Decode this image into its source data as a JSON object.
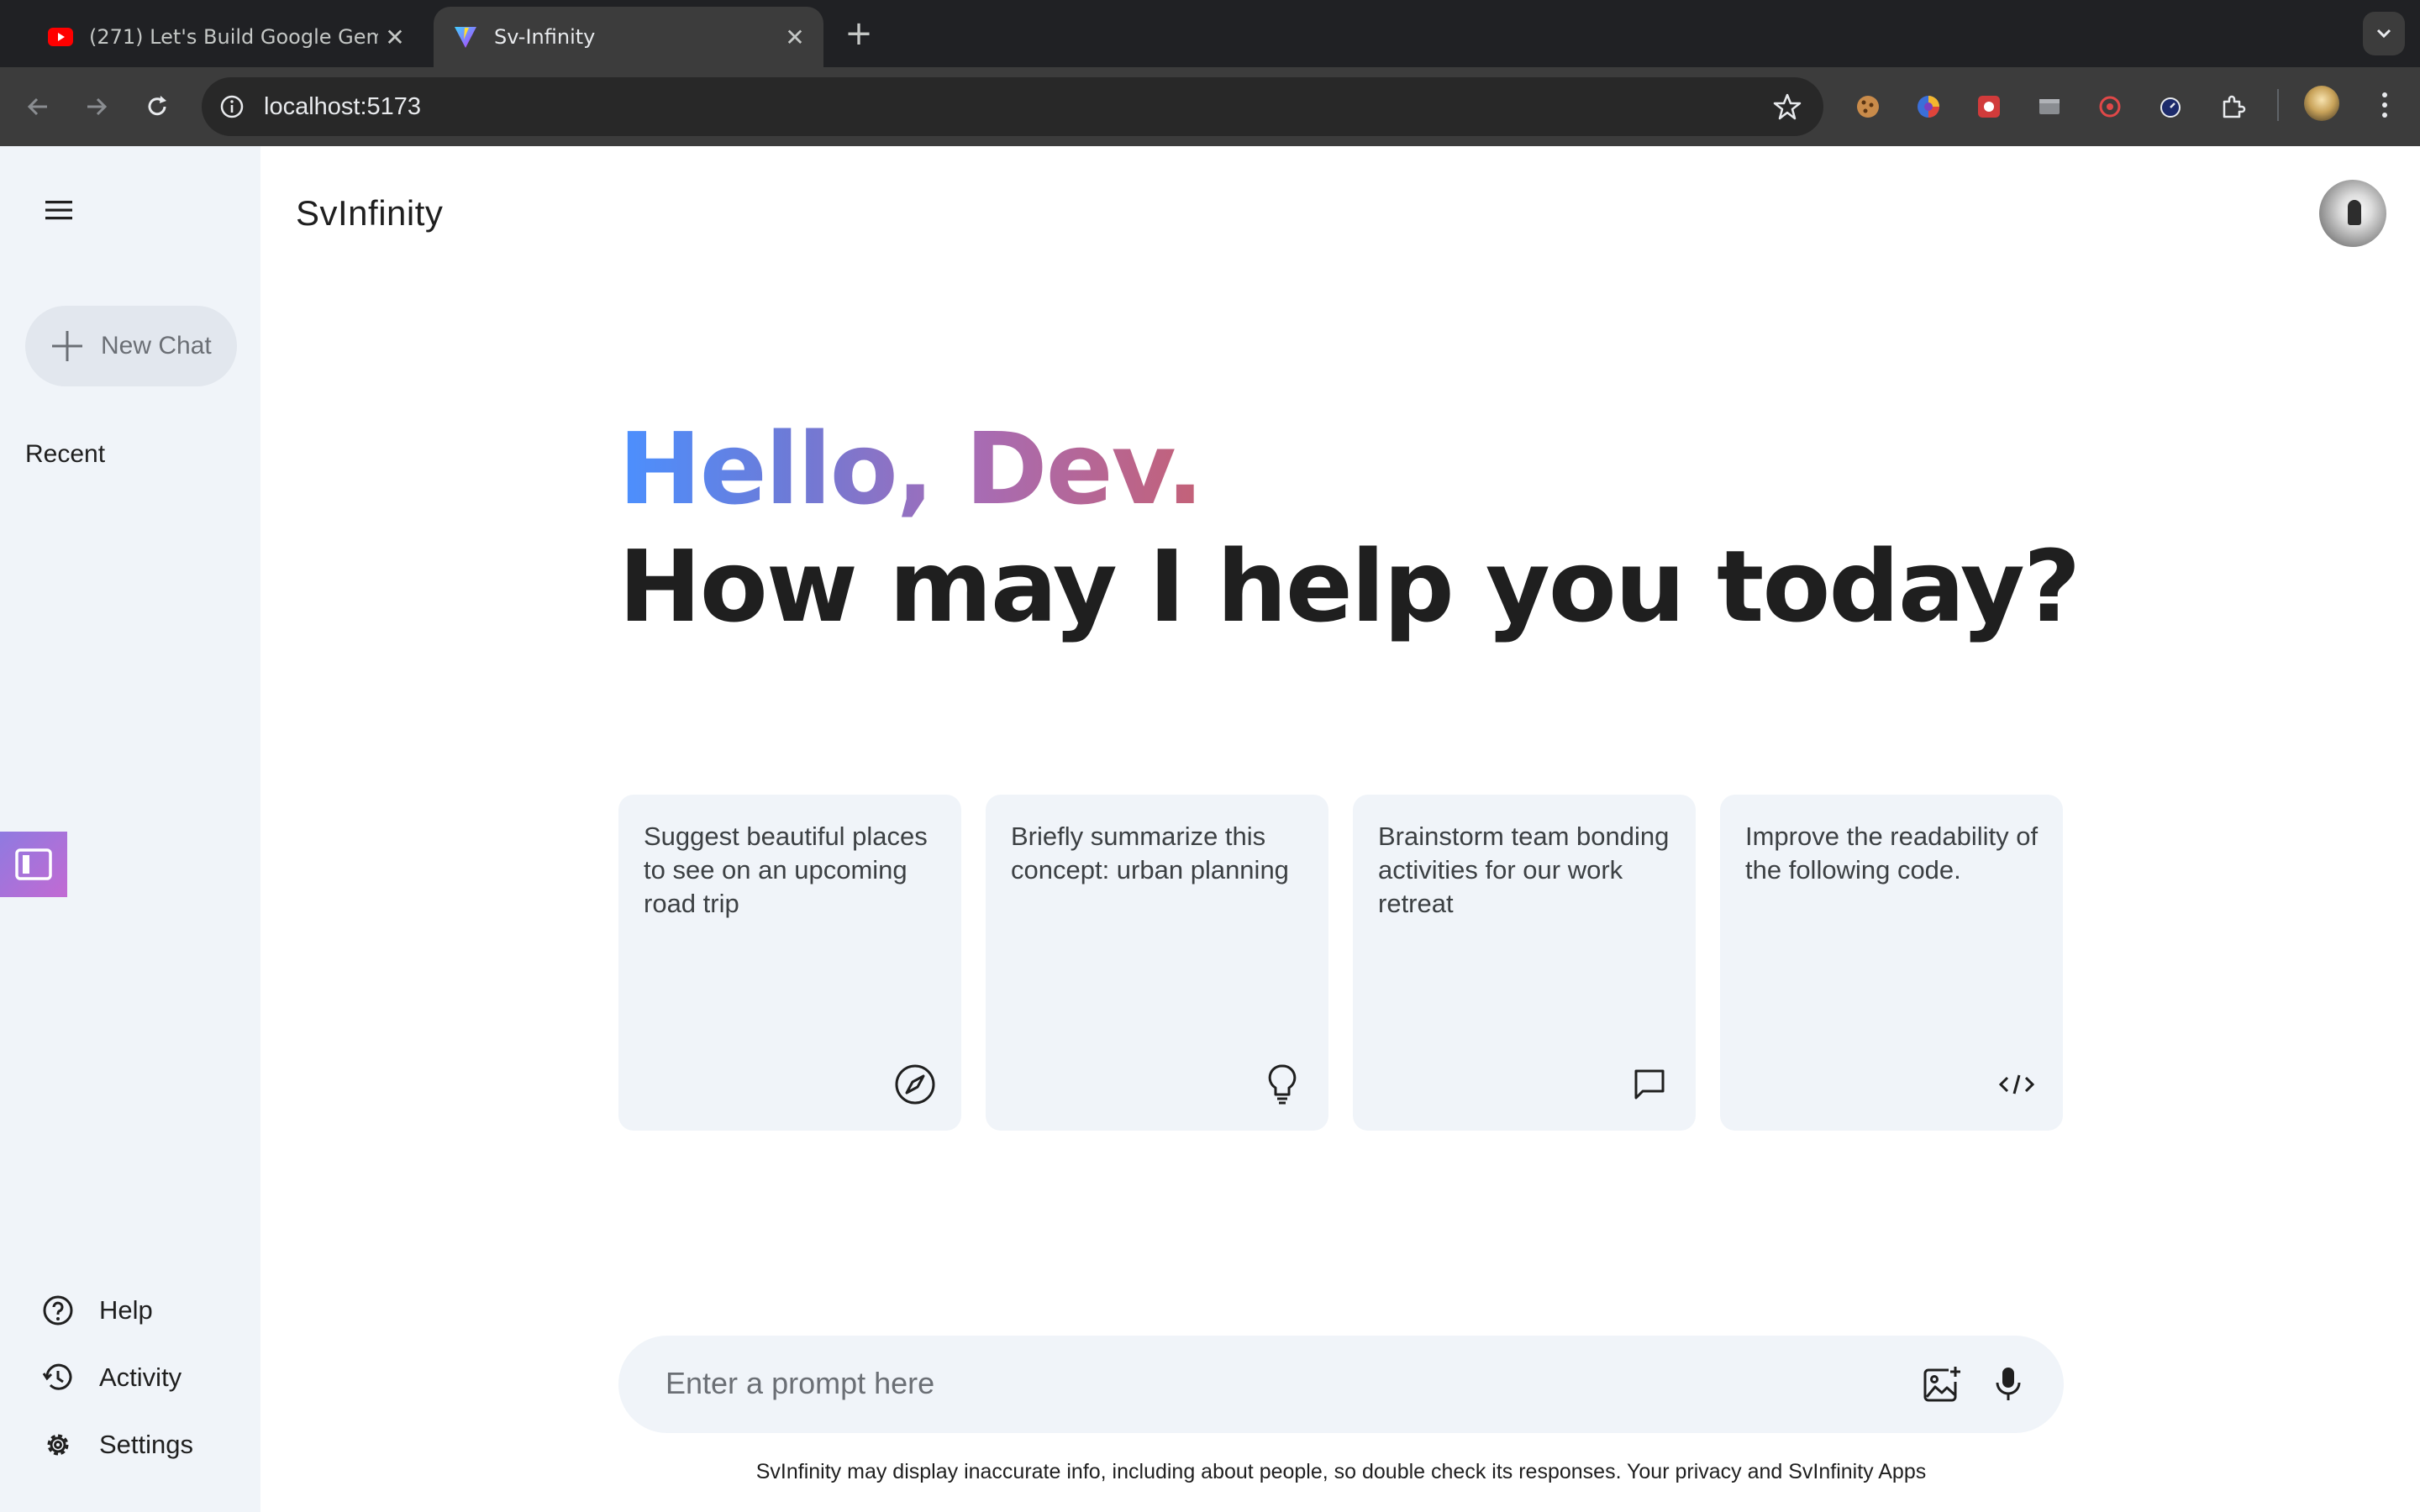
{
  "browser": {
    "tabs": [
      {
        "title": "(271) Let's Build Google Gem",
        "favicon": "youtube-icon",
        "active": false
      },
      {
        "title": "Sv-Infinity",
        "favicon": "vite-icon",
        "active": true
      }
    ],
    "url": "localhost:5173",
    "extensions": [
      "cookie-extension-icon",
      "color-picker-extension-icon",
      "red-extension-icon",
      "window-extension-icon",
      "record-extension-icon",
      "timer-extension-icon",
      "puzzle-extensions-icon"
    ]
  },
  "sidebar": {
    "new_chat_label": "New Chat",
    "recent_label": "Recent",
    "bottom_items": [
      {
        "label": "Help",
        "icon": "help-icon"
      },
      {
        "label": "Activity",
        "icon": "history-icon"
      },
      {
        "label": "Settings",
        "icon": "gear-icon"
      }
    ]
  },
  "header": {
    "brand": "SvInfinity"
  },
  "greeting": {
    "hello": "Hello, Dev.",
    "question": "How may I help you today?"
  },
  "cards": [
    {
      "text": "Suggest beautiful places to see on an upcoming road trip",
      "icon": "compass-icon"
    },
    {
      "text": "Briefly summarize this concept: urban planning",
      "icon": "bulb-icon"
    },
    {
      "text": "Brainstorm team bonding activities for our work retreat",
      "icon": "message-icon"
    },
    {
      "text": "Improve the readability of the following code.",
      "icon": "code-icon"
    }
  ],
  "prompt": {
    "placeholder": "Enter a prompt here"
  },
  "disclaimer": "SvInfinity may display inaccurate info, including about people, so double check its responses. Your privacy and SvInfinity Apps",
  "colors": {
    "sidebar_bg": "#f0f4f9",
    "gradient_start": "#4b90ff",
    "gradient_end": "#c46177",
    "text_dark": "#1f1f1f"
  }
}
